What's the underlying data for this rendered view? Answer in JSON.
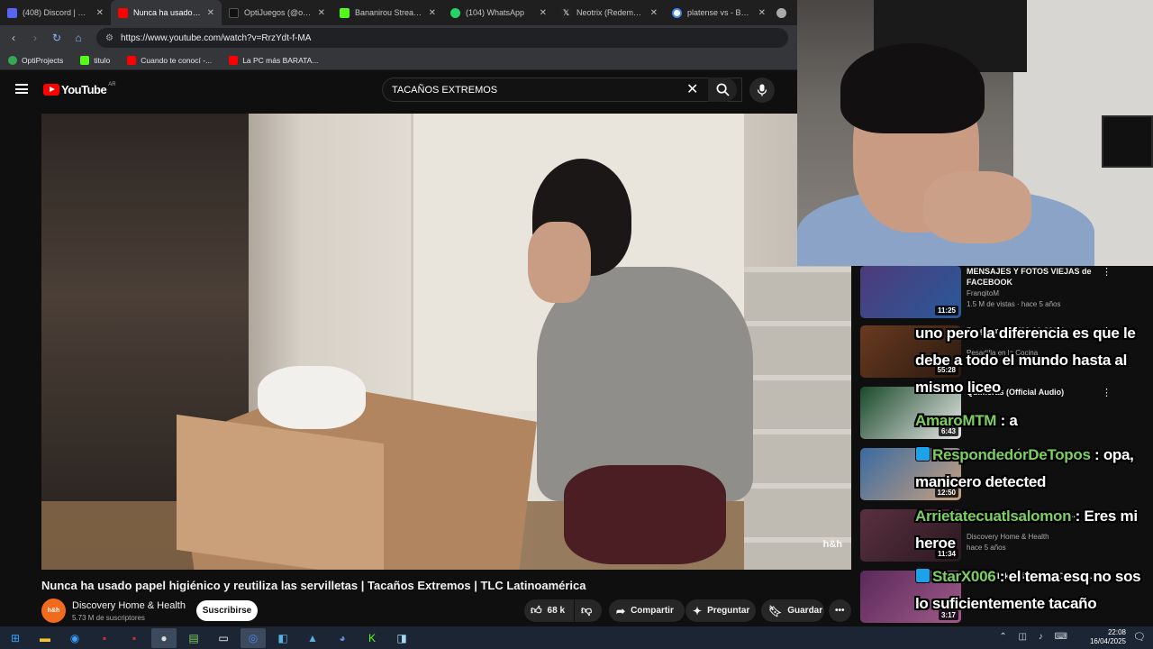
{
  "browser": {
    "tabs": [
      {
        "label": "(408) Discord | @que",
        "color": "#5865f2"
      },
      {
        "label": "Nunca ha usado pape",
        "color": "#ff0000",
        "active": true
      },
      {
        "label": "OptiJuegos (@optiju",
        "color": "#111111"
      },
      {
        "label": "Bananirou Stream - V",
        "color": "#53fc18"
      },
      {
        "label": "(104) WhatsApp",
        "color": "#25d366"
      },
      {
        "label": "Neotrix (Redemption",
        "color": "#222222"
      },
      {
        "label": "platense vs - Buscar",
        "color": "#4285f4"
      }
    ],
    "url": "https://www.youtube.com/watch?v=RrzYdt-f-MA",
    "bookmarks": [
      {
        "label": "OptiProjects",
        "color": "#34a853"
      },
      {
        "label": "titulo",
        "color": "#53fc18"
      },
      {
        "label": "Cuando te conocí -...",
        "color": "#ff0000"
      },
      {
        "label": "La PC más BARATA...",
        "color": "#ff0000"
      }
    ]
  },
  "youtube": {
    "logo": "YouTube",
    "country": "AR",
    "search_value": "TACAÑOS EXTREMOS",
    "video_watermark": "h&h",
    "video_title": "Nunca ha usado papel higiénico y reutiliza las servilletas | Tacaños Extremos | TLC Latinoamérica",
    "channel": {
      "name": "Discovery Home & Health",
      "subscribers": "5.73 M de suscriptores",
      "avatar_text": "h&h"
    },
    "subscribe_label": "Suscribirse",
    "actions": {
      "likes": "68 k",
      "share": "Compartir",
      "ask": "Preguntar",
      "save": "Guardar"
    },
    "recommendations": [
      {
        "title": "MENSAJES Y FOTOS VIEJAS de FACEBOOK",
        "channel": "FranqitoM",
        "meta": "1.5 M de vistas · hace 5 años",
        "duration": "11:25",
        "thumb_color": "#4d3a7a"
      },
      {
        "title": "Programa 05 (03-10-2016)",
        "channel": "Pesadilla en la Cocina",
        "meta": "",
        "duration": "55:28",
        "thumb_color": "#6a3a20"
      },
      {
        "title": "Quimeras (Official Audio)",
        "channel": "",
        "meta": "",
        "duration": "6:43",
        "thumb_color": "#1a4a2a"
      },
      {
        "title": "LA TELEVISIÓN !!",
        "channel": "",
        "meta": "",
        "duration": "12:50",
        "thumb_color": "#3a6aa0"
      },
      {
        "title": "negro y su madre se niega ...",
        "channel": "Discovery Home & Health",
        "meta": "hace 5 años",
        "duration": "11:34",
        "thumb_color": "#5a3040"
      },
      {
        "title": "Round (Like a Record) (Official...",
        "channel": "",
        "meta": "",
        "duration": "3:17",
        "thumb_color": "#5a2a5a"
      }
    ]
  },
  "chat": [
    {
      "user": "",
      "message": "uno pero la diferencia es que le debe a todo el mundo hasta al mismo liceo"
    },
    {
      "user": "AmaroMTM",
      "message": "a"
    },
    {
      "user": "RespondedorDeTopos",
      "message": "opa, manicero detected",
      "badge": true
    },
    {
      "user": "Arrietatecuatlsalomon",
      "message": "Eres mi heroe"
    },
    {
      "user": "StarX006",
      "message": "el tema esq no sos lo suficientemente tacaño",
      "badge": true
    }
  ],
  "taskbar": {
    "time": "22:08",
    "date": "16/04/2025"
  }
}
